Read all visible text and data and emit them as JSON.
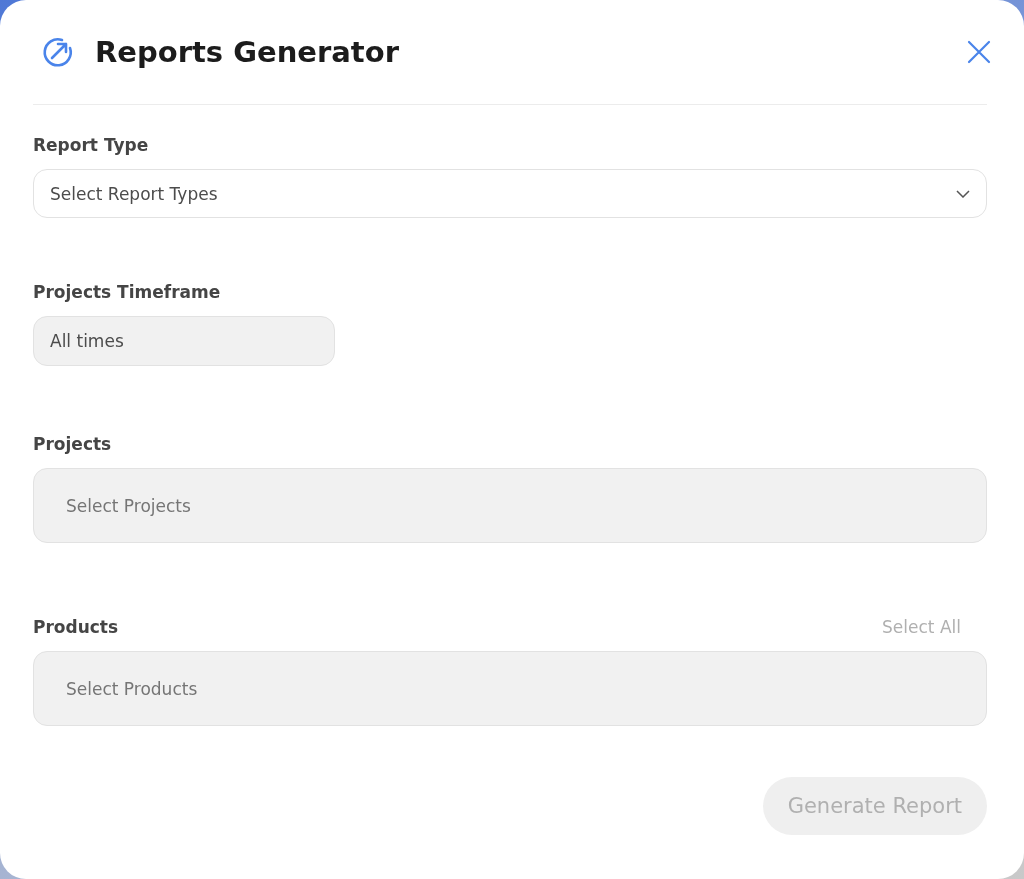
{
  "dialog": {
    "title": "Reports Generator"
  },
  "sections": [
    {
      "label": "Report Type",
      "kind": "dropdown",
      "placeholder": "Select Report Types"
    },
    {
      "label": "Projects Timeframe",
      "kind": "chip",
      "value": "All times"
    },
    {
      "label": "Projects",
      "kind": "multiselect",
      "placeholder": "Select Projects"
    },
    {
      "label": "Products",
      "kind": "multiselect",
      "placeholder": "Select Products",
      "action": "Select All"
    }
  ],
  "submit": {
    "label": "Generate Report",
    "disabled": true
  }
}
